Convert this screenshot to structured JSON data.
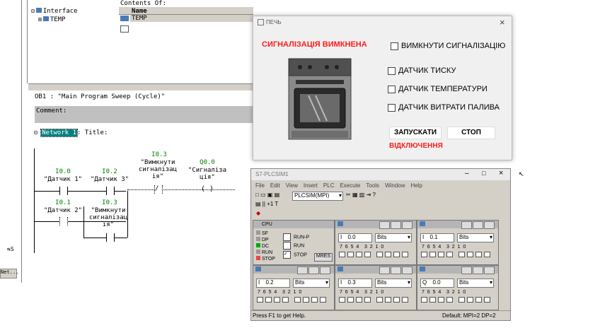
{
  "step7": {
    "contents_label": "Contents Of: 'Environment\\Interface'",
    "tree_root": "Interface",
    "tree_child": "TEMP",
    "col_name": "Name",
    "row_temp": "TEMP",
    "ob_title": "OB1 :  \"Main Program Sweep (Cycle)\"",
    "comment": "Comment:",
    "network": "Network 1",
    "network_title": ": Title:",
    "net_tab": "Net...",
    "rungs": [
      {
        "addr": "I0.0",
        "name": "\"Датчик 1\""
      },
      {
        "addr": "I0.2",
        "name": "\"Датчик 3\""
      },
      {
        "addr": "I0.3",
        "name": "\"Вимкнути\nсигналізац\nія\""
      },
      {
        "addr": "Q0.0",
        "name": "\"Сигналіза\nція\""
      },
      {
        "addr": "I0.1",
        "name": "\"Датчик 2\""
      },
      {
        "addr": "I0.3",
        "name": "\"Вимкнути\nсигналізац\nія\""
      }
    ]
  },
  "oven": {
    "title": "ПЕЧЬ",
    "alarm": "СИГНАЛІЗАЦІЯ ВИМКНЕНА",
    "chk_off": "ВИМКНУТИ СИГНАЛІЗАЦІЮ",
    "chk_pressure": "ДАТЧИК ТИСКУ",
    "chk_temp": "ДАТЧИК ТЕМПЕРАТУРИ",
    "chk_fuel": "ДАТЧИК ВИТРАТИ ПАЛИВА",
    "btn_start": "ЗАПУСКАТИ",
    "btn_stop": "СТОП",
    "status": "ВІДКЛЮЧЕННЯ",
    "close": "×",
    "colors": {
      "alarm": "#ff1a1a",
      "status": "#ff1a1a"
    }
  },
  "plcsim": {
    "title": "S7-PLCSIM1",
    "menu": [
      "File",
      "Edit",
      "View",
      "Insert",
      "PLC",
      "Execute",
      "Tools",
      "Window",
      "Help"
    ],
    "mpi": "PLCSIM(MPI)",
    "cpu": {
      "title": "CPU",
      "leds": [
        "SF",
        "DP",
        "DC",
        "RUN",
        "STOP"
      ],
      "runp": "RUN-P",
      "run": "RUN",
      "stop": "STOP",
      "mres": "MRES"
    },
    "modules": [
      {
        "addr": "0.0",
        "fmt": "Bits"
      },
      {
        "addr": "0.1",
        "fmt": "Bits"
      },
      {
        "addr": "0.2",
        "fmt": "Bits"
      },
      {
        "addr": "0.3",
        "fmt": "Bits"
      },
      {
        "addr": "0.0",
        "fmt": "Bits"
      }
    ],
    "io_prefix": [
      "I",
      "I",
      "I",
      "I",
      "Q"
    ],
    "bit_labels": "7  6  5  4    3  2  1  0",
    "status_left": "Press F1 to get Help.",
    "status_right": "Default:  MPI=2 DP=2"
  }
}
